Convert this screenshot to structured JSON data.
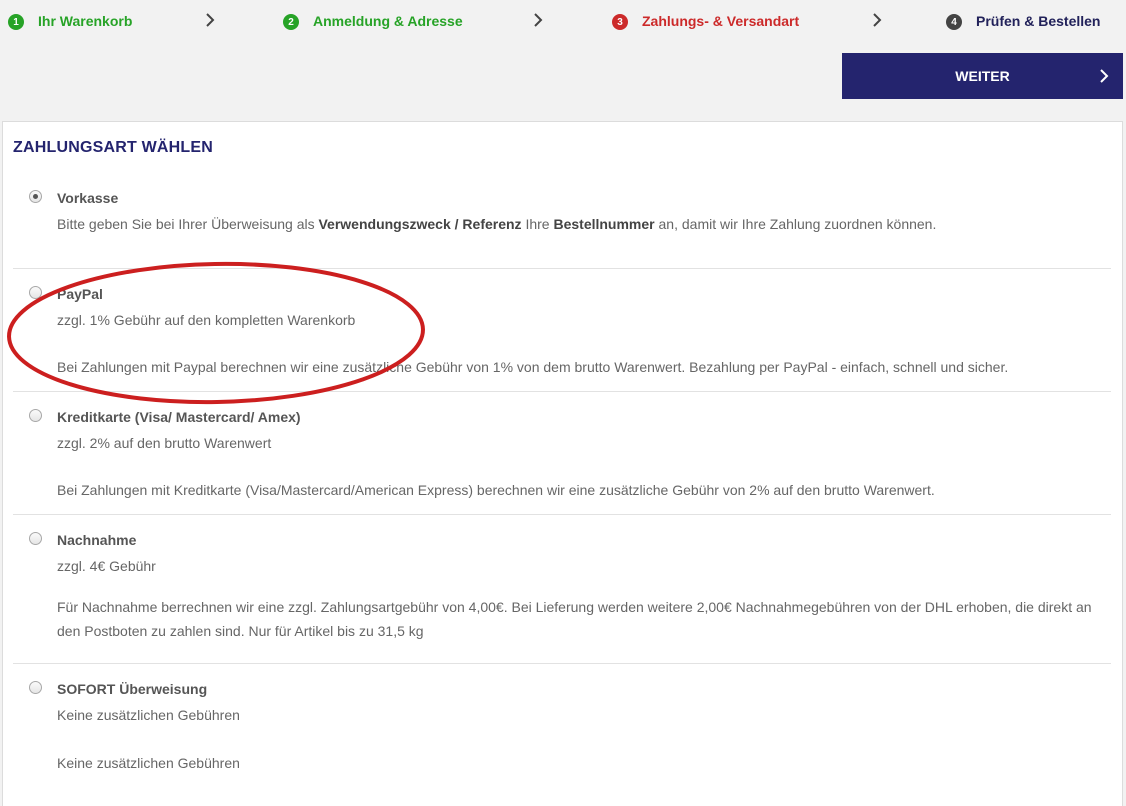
{
  "steps": [
    {
      "num": "1",
      "label": "Ihr Warenkorb"
    },
    {
      "num": "2",
      "label": "Anmeldung & Adresse"
    },
    {
      "num": "3",
      "label": "Zahlungs- & Versandart"
    },
    {
      "num": "4",
      "label": "Prüfen & Bestellen"
    }
  ],
  "weiter_label": "WEITER",
  "section_title": "ZAHLUNGSART WÄHLEN",
  "options": [
    {
      "name": "Vorkasse",
      "desc_pre": "Bitte geben Sie bei Ihrer Überweisung als ",
      "desc_bold1": "Verwendungszweck / Referenz",
      "desc_mid": " Ihre ",
      "desc_bold2": "Bestellnummer",
      "desc_post": " an, damit wir Ihre Zahlung zuordnen können.",
      "selected": true
    },
    {
      "name": "PayPal",
      "fee": "zzgl. 1% Gebühr auf den kompletten Warenkorb",
      "desc": "Bei Zahlungen mit Paypal berechnen wir eine zusätzliche Gebühr von 1% von dem brutto Warenwert. Bezahlung per PayPal - einfach, schnell und sicher.",
      "selected": false
    },
    {
      "name": "Kreditkarte (Visa/ Mastercard/ Amex)",
      "fee": "zzgl. 2% auf den brutto Warenwert",
      "desc": "Bei Zahlungen mit Kreditkarte (Visa/Mastercard/American Express) berechnen wir eine zusätzliche Gebühr von 2% auf den brutto Warenwert.",
      "selected": false
    },
    {
      "name": "Nachnahme",
      "fee": "zzgl. 4€ Gebühr",
      "desc": "Für Nachnahme berrechnen wir eine zzgl. Zahlungsartgebühr von 4,00€. Bei Lieferung werden weitere 2,00€ Nachnahmegebühren von der DHL erhoben, die direkt an den Postboten zu zahlen sind. Nur für Artikel bis zu 31,5 kg",
      "selected": false
    },
    {
      "name": "SOFORT Überweisung",
      "fee": "Keine zusätzlichen Gebühren",
      "desc": "Keine zusätzlichen Gebühren",
      "selected": false
    }
  ],
  "colors": {
    "step_done": "#27a327",
    "step_active": "#cc2a2a",
    "step_next": "#22225a",
    "primary_button": "#24246e",
    "annotation": "#cc1f1f"
  }
}
